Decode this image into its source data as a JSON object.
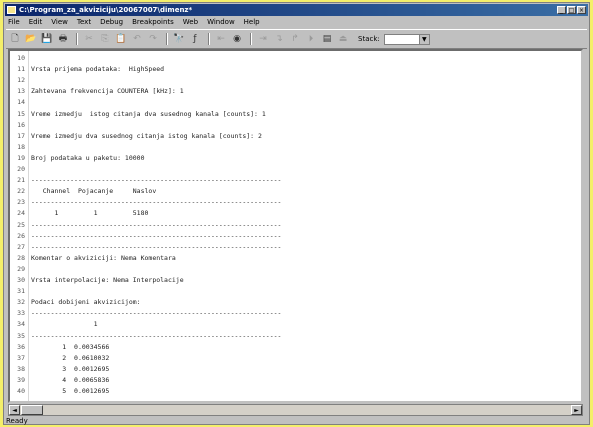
{
  "window": {
    "title": "C:\\Program_za_akviziciju\\20067007\\dimenz*",
    "controls": [
      "_",
      "□",
      "×"
    ]
  },
  "menu": [
    "File",
    "Edit",
    "View",
    "Text",
    "Debug",
    "Breakpoints",
    "Web",
    "Window",
    "Help"
  ],
  "toolbar": {
    "buttons": [
      {
        "name": "new-file-icon",
        "glyph": "🗋",
        "dim": false
      },
      {
        "name": "open-folder-icon",
        "glyph": "📂",
        "dim": false
      },
      {
        "name": "save-icon",
        "glyph": "💾",
        "dim": false
      },
      {
        "name": "print-icon",
        "glyph": "🖶",
        "dim": false
      },
      {
        "name": "sep",
        "glyph": "",
        "dim": false
      },
      {
        "name": "cut-icon",
        "glyph": "✂",
        "dim": true
      },
      {
        "name": "copy-icon",
        "glyph": "⎘",
        "dim": true
      },
      {
        "name": "paste-icon",
        "glyph": "📋",
        "dim": true
      },
      {
        "name": "undo-icon",
        "glyph": "↶",
        "dim": true
      },
      {
        "name": "redo-icon",
        "glyph": "↷",
        "dim": true
      },
      {
        "name": "sep",
        "glyph": "",
        "dim": false
      },
      {
        "name": "find-icon",
        "glyph": "🔭",
        "dim": false
      },
      {
        "name": "function-icon",
        "glyph": "ƒ",
        "dim": false
      },
      {
        "name": "sep",
        "glyph": "",
        "dim": false
      },
      {
        "name": "back-icon",
        "glyph": "⇤",
        "dim": true
      },
      {
        "name": "breakpoint-icon",
        "glyph": "◉",
        "dim": false
      },
      {
        "name": "sep",
        "glyph": "",
        "dim": false
      },
      {
        "name": "step-icon",
        "glyph": "⇥",
        "dim": true
      },
      {
        "name": "step-in-icon",
        "glyph": "↴",
        "dim": true
      },
      {
        "name": "step-out-icon",
        "glyph": "↱",
        "dim": true
      },
      {
        "name": "continue-icon",
        "glyph": "⏵",
        "dim": true
      },
      {
        "name": "stack-icon",
        "glyph": "▤",
        "dim": false
      },
      {
        "name": "exit-debug-icon",
        "glyph": "⏏",
        "dim": true
      }
    ],
    "font_label": "Stack:"
  },
  "editor": {
    "lines": [
      {
        "n": "10",
        "t": ""
      },
      {
        "n": "11",
        "t": "Vrsta prijema podataka:  HighSpeed"
      },
      {
        "n": "12",
        "t": ""
      },
      {
        "n": "13",
        "t": "Zahtevana frekvencija COUNTERA [kHz]: 1"
      },
      {
        "n": "14",
        "t": ""
      },
      {
        "n": "15",
        "t": "Vreme izmedju  istog citanja dva susednog kanala [counts]: 1"
      },
      {
        "n": "16",
        "t": ""
      },
      {
        "n": "17",
        "t": "Vreme izmedju dva susednog citanja istog kanala [counts]: 2"
      },
      {
        "n": "18",
        "t": ""
      },
      {
        "n": "19",
        "t": "Broj podataka u paketu: 10000"
      },
      {
        "n": "20",
        "t": ""
      },
      {
        "n": "21",
        "t": "----------------------------------------------------------------"
      },
      {
        "n": "22",
        "t": "   Channel  Pojacanje     Naslov"
      },
      {
        "n": "23",
        "t": "----------------------------------------------------------------"
      },
      {
        "n": "24",
        "t": "      1         1         5180"
      },
      {
        "n": "25",
        "t": "----------------------------------------------------------------"
      },
      {
        "n": "26",
        "t": "----------------------------------------------------------------"
      },
      {
        "n": "27",
        "t": "----------------------------------------------------------------"
      },
      {
        "n": "28",
        "t": "Komentar o akviziciji: Nema Komentara"
      },
      {
        "n": "29",
        "t": ""
      },
      {
        "n": "30",
        "t": "Vrsta interpolacije: Nema Interpolacije"
      },
      {
        "n": "31",
        "t": ""
      },
      {
        "n": "32",
        "t": "Podaci dobijeni akvizicijom:"
      },
      {
        "n": "33",
        "t": "----------------------------------------------------------------"
      },
      {
        "n": "34",
        "t": "                1"
      },
      {
        "n": "35",
        "t": "----------------------------------------------------------------"
      },
      {
        "n": "36",
        "t": "        1  0.0034566"
      },
      {
        "n": "37",
        "t": "        2  0.0610032"
      },
      {
        "n": "38",
        "t": "        3  0.0012695"
      },
      {
        "n": "39",
        "t": "        4  0.0065836"
      },
      {
        "n": "40",
        "t": "        5  0.0012695"
      }
    ]
  },
  "scroll": {
    "left": "◄",
    "right": "►"
  },
  "status": {
    "text": "Ready"
  }
}
